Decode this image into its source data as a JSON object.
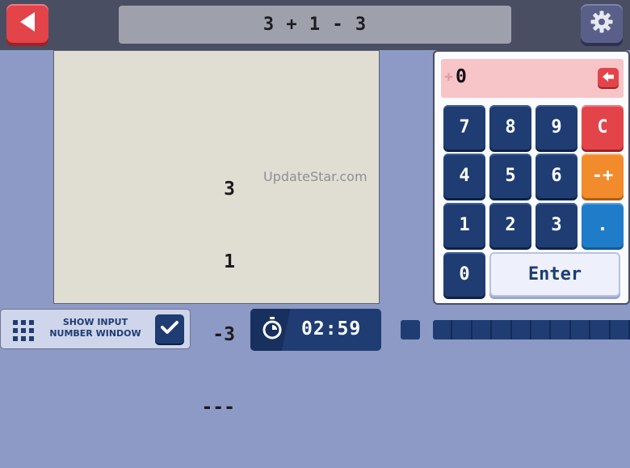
{
  "header": {
    "back_icon": "back-arrow-icon",
    "expression": "3 + 1 - 3",
    "settings_icon": "gear-icon"
  },
  "board": {
    "operands": [
      "3",
      "1",
      "-3"
    ],
    "divider": "---",
    "watermark": "UpdateStar.com"
  },
  "keypad": {
    "display_sign": "+",
    "display_value": "0",
    "display_back_icon": "backspace-arrow-icon",
    "keys": {
      "k7": "7",
      "k8": "8",
      "k9": "9",
      "clear": "C",
      "k4": "4",
      "k5": "5",
      "k6": "6",
      "sign": "-+",
      "k1": "1",
      "k2": "2",
      "k3": "3",
      "dot": ".",
      "k0": "0",
      "enter": "Enter"
    }
  },
  "footer": {
    "show_input_label_line1": "SHOW INPUT",
    "show_input_label_line2": "NUMBER WINDOW",
    "show_input_checked": true,
    "timer": "02:59",
    "timer_icon": "stopwatch-icon",
    "progress_segments": 10
  },
  "colors": {
    "background": "#8d9ac6",
    "topbar": "#4a4e63",
    "navy": "#1f3d73",
    "red": "#e2444a",
    "orange": "#f18b2b",
    "blue": "#1f7cc8"
  }
}
